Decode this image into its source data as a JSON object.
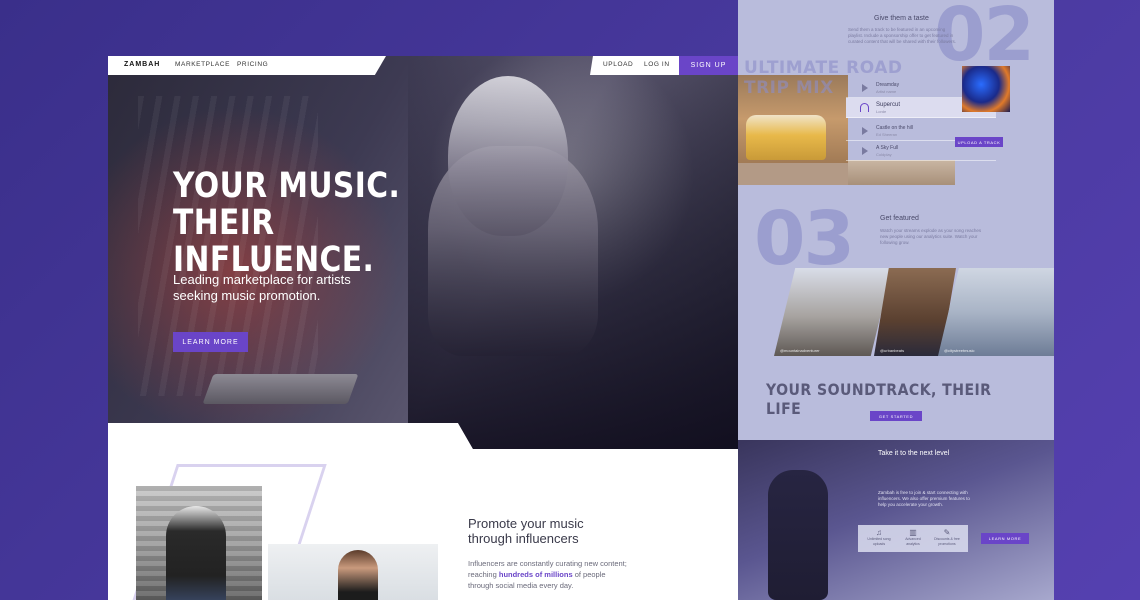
{
  "nav": {
    "brand": "ZAMBAH",
    "links": [
      "MARKETPLACE",
      "PRICING"
    ],
    "right_links": [
      "UPLOAD",
      "LOG IN"
    ],
    "signup": "SIGN UP"
  },
  "hero": {
    "title_line1": "YOUR MUSIC.",
    "title_line2": "THEIR INFLUENCE.",
    "subtitle_line1": "Leading marketplace for artists",
    "subtitle_line2": "seeking music promotion.",
    "cta": "LEARN MORE"
  },
  "promo": {
    "title_line1": "Promote your music",
    "title_line2": "through influencers",
    "text_before": "Influencers are constantly curating new content; reaching ",
    "highlight": "hundreds of millions",
    "text_after": " of people through social media every day."
  },
  "panel": {
    "step2": {
      "number": "02",
      "heading": "Give them a taste",
      "paragraph": "Send them a track to be featured in an upcoming playlist. Include a sponsorship offer to get featured in curated content that will be shared with their followers.",
      "playlist_title": "ULTIMATE ROAD TRIP MIX",
      "tracks": [
        {
          "title": "Dreamday",
          "artist": "Artist name"
        },
        {
          "title": "Supercut",
          "artist": "Lorde"
        },
        {
          "title": "Castle on the hill",
          "artist": "Ed Sheeran"
        },
        {
          "title": "A Sky Full",
          "artist": "Coldplay"
        }
      ],
      "upload_button": "UPLOAD A TRACK"
    },
    "step3": {
      "number": "03",
      "heading": "Get featured",
      "paragraph": "Watch your streams explode as your song reaches new people using our analytics suite. Watch your following grow.",
      "photo_captions": [
        "@mountainadventurer",
        "@urbanbeats",
        "@citystreetmusic"
      ],
      "soundtrack_title": "YOUR SOUNDTRACK, THEIR LIFE",
      "get_started": "GET STARTED"
    },
    "step4": {
      "heading": "Take it to the next level",
      "paragraph": "Zambah is free to join & start connecting with influencers. We also offer premium features to help you accelerate your growth.",
      "features": [
        {
          "icon": "music-note-icon",
          "glyph": "♫",
          "label": "Unlimited song uploads"
        },
        {
          "icon": "chart-icon",
          "glyph": "▥",
          "label": "Advanced analytics"
        },
        {
          "icon": "priority-icon",
          "glyph": "✎",
          "label": "Discounts & free promotions"
        }
      ],
      "learn_more": "LEARN MORE"
    }
  },
  "colors": {
    "accent": "#6a45c8",
    "background": "#3a2f8a",
    "panel": "#b9bcdc"
  }
}
